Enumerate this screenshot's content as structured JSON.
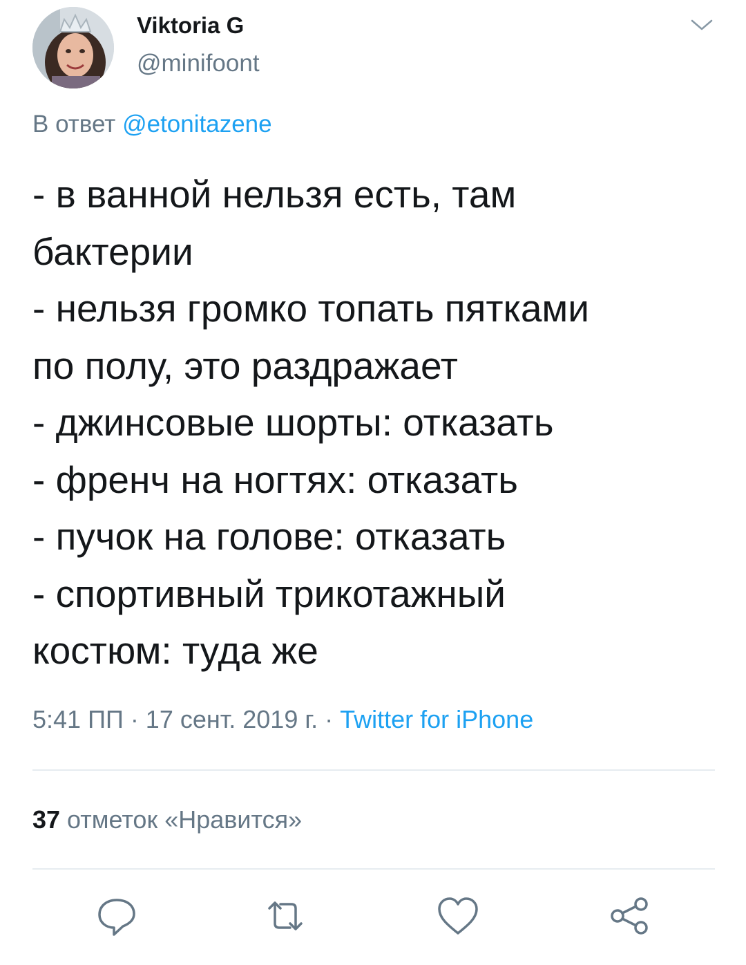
{
  "author": {
    "name": "Viktoria G",
    "handle": "@minifoont"
  },
  "reply": {
    "prefix": "В ответ",
    "mention": "@etonitazene"
  },
  "tweet": {
    "text": "- в ванной нельзя есть, там\nбактерии\n- нельзя громко топать пятками\nпо полу, это раздражает\n- джинсовые шорты: отказать\n- френч на ногтях: отказать\n- пучок на голове: отказать\n- спортивный трикотажный\nкостюм: туда же"
  },
  "meta": {
    "timestamp": "5:41 ПП · 17 сент. 2019 г. ·",
    "source": "Twitter for iPhone"
  },
  "likes": {
    "count": "37",
    "label": "отметок «Нравится»"
  },
  "icons": {
    "more": "chevron-down-icon",
    "reply": "reply-icon",
    "retweet": "retweet-icon",
    "like": "heart-icon",
    "share": "share-icon"
  },
  "colors": {
    "link": "#1da1f2",
    "secondary_text": "#657786",
    "primary_text": "#14171a",
    "divider": "#e6ecf0"
  }
}
